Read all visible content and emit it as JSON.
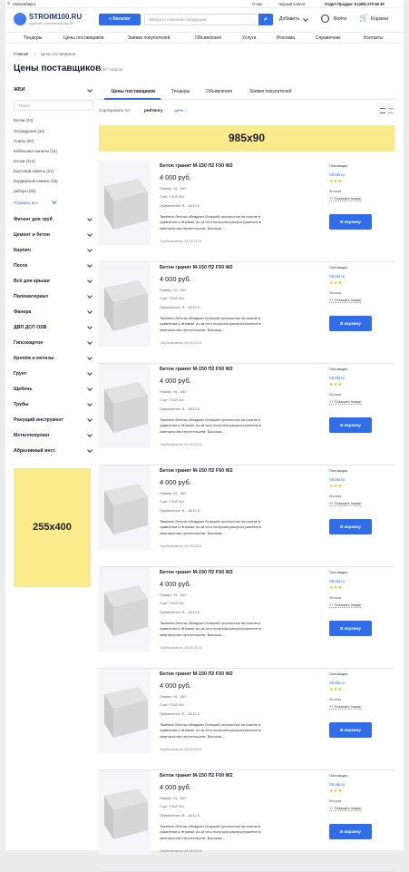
{
  "topbar": {
    "city": "Новосибирск",
    "about": "О нас",
    "blacklist": "Черный список",
    "sales": "Отдел Продаж: 8 (499) 270 58 45"
  },
  "header": {
    "logo_title": "STROIM100.RU",
    "logo_sub": "Крупный строительный портал",
    "catalog": "Каталог",
    "search_placeholder": "Введите название продукции",
    "add": "Добавить",
    "login": "Войти",
    "cart": "Корзина"
  },
  "nav": [
    "Тендеры",
    "Цены поставщиков",
    "Заявки покупателей",
    "Объявления",
    "Услуги",
    "Реклама",
    "Справочник",
    "Контакты"
  ],
  "breadcrumb": {
    "home": "Главная",
    "sep": ">",
    "current": "Цены поставщиков"
  },
  "page": {
    "title": "Цены поставщиков",
    "count": "2140 товаров"
  },
  "sidebar": {
    "group_title": "ЖБИ",
    "search_placeholder": "Поиск",
    "subitems": [
      "Балки (24)",
      "Ограждения (32)",
      "Плиты (97)",
      "Кабельные каналы (12)",
      "Блоки (213)",
      "Бортовой камень (21)",
      "Бордюрный камень (18)",
      "Заборы (82)"
    ],
    "show_all": "Показать все",
    "categories": [
      "Фитинг для труб",
      "Цемент и бетон",
      "Кирпич",
      "Песок",
      "Всё для крыши",
      "Пиломатериал",
      "Фанера",
      "ДВП ДСП OSB",
      "Гипсокартон",
      "Крепёж и метизы",
      "Грунт",
      "Щебень",
      "Трубы",
      "Режущий инструмент",
      "Металлопрокат",
      "Абразивный инст."
    ],
    "ad_label": "255x400"
  },
  "tabs": [
    "Цены поставщиков",
    "Тендеры",
    "Объявления",
    "Заявки покупателей"
  ],
  "sort": {
    "label": "Сортировать по:",
    "rating": "рейтингу",
    "price": "цене ↑"
  },
  "banner": {
    "label": "985x90"
  },
  "colors": {
    "accent": "#2f6ee8",
    "ad_yellow": "#f9eb8c",
    "star": "#f1b300"
  },
  "product": {
    "title": "Бетон гранит М-150 П2 F50 W2",
    "price": "4 000 руб.",
    "size": "Размер: М - 150",
    "grade": "Сорт: F100 W4",
    "use": "Применение: В - 15/12,5",
    "desc": "Тяжёлые бетоны обладают большей прочностью на сжатие в сравнении с лёгкими, из-за чего получили распространение в капитальном строительстве. Высокая ...",
    "published": "Опубликовано 24.05.2021",
    "supplier_label": "Поставщик:",
    "supplier": "Stroiki.ru",
    "stars": "★★★",
    "city": "Москва",
    "phone": "+7 Показать номер",
    "cart": "В корзину"
  }
}
